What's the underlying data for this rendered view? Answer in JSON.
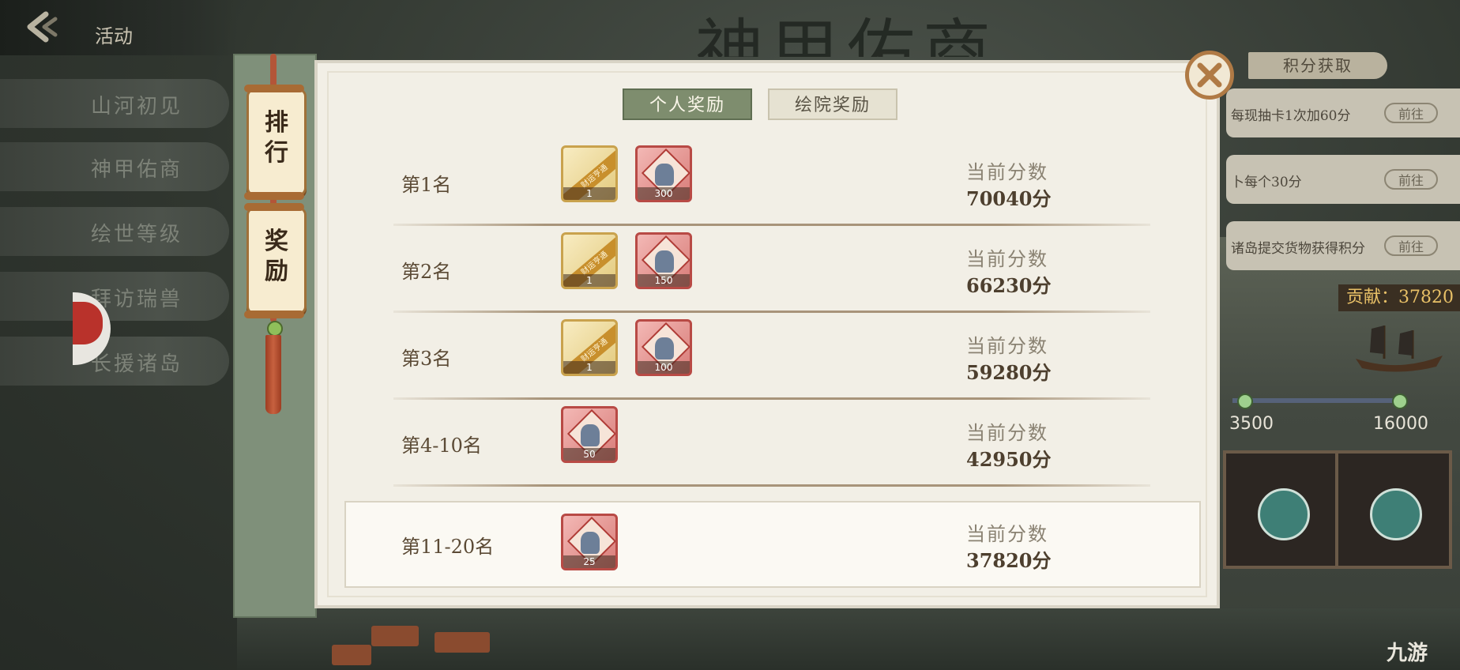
{
  "header": {
    "title": "活动",
    "back_icon": "back-arrow-icon"
  },
  "background": {
    "title_partial": "神甲佑商"
  },
  "nav": {
    "items": [
      {
        "label": "山河初见"
      },
      {
        "label": "神甲佑商"
      },
      {
        "label": "绘世等级"
      },
      {
        "label": "拜访瑞兽"
      },
      {
        "label": "长援诸岛"
      }
    ]
  },
  "side_tabs": {
    "rank": "排行",
    "reward": "奖励"
  },
  "dialog": {
    "tabs": {
      "personal": "个人奖励",
      "academy": "绘院奖励"
    },
    "score_label": "当前分数",
    "rows": [
      {
        "rank": "第1名",
        "score": "70040分",
        "items": [
          {
            "type": "gold",
            "ribbon": "财运亨通",
            "count": "1"
          },
          {
            "type": "red",
            "count": "300"
          }
        ]
      },
      {
        "rank": "第2名",
        "score": "66230分",
        "items": [
          {
            "type": "gold",
            "ribbon": "财运亨通",
            "count": "1"
          },
          {
            "type": "red",
            "count": "150"
          }
        ]
      },
      {
        "rank": "第3名",
        "score": "59280分",
        "items": [
          {
            "type": "gold",
            "ribbon": "财运亨通",
            "count": "1"
          },
          {
            "type": "red",
            "count": "100"
          }
        ]
      },
      {
        "rank": "第4-10名",
        "score": "42950分",
        "items": [
          {
            "type": "red",
            "count": "50"
          }
        ]
      }
    ],
    "current": {
      "rank": "第11-20名",
      "score": "37820分",
      "items": [
        {
          "type": "red",
          "count": "25"
        }
      ]
    }
  },
  "right_panel": {
    "heading": "积分获取",
    "tasks": [
      {
        "text": "每现抽卡1次加60分",
        "button": "前往"
      },
      {
        "text": "卜每个30分",
        "button": "前往"
      },
      {
        "text": "诸岛提交货物获得积分",
        "button": "前往"
      }
    ],
    "contribution": "贡献：37820",
    "milestones": [
      "3500",
      "16000"
    ]
  },
  "watermark": "九游",
  "colors": {
    "active_tab": "#7e8d6e",
    "dialog_bg": "#f2efe6",
    "accent_brown": "#b07a45"
  }
}
